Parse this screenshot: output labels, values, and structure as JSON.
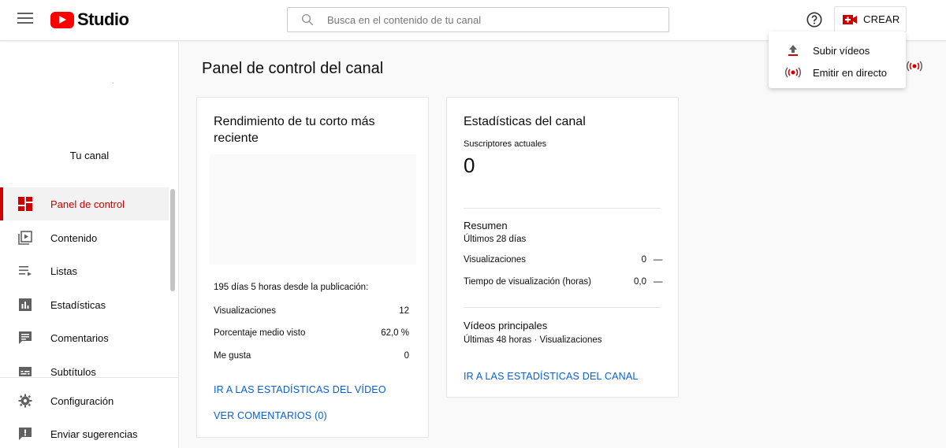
{
  "header": {
    "logo_text": "Studio",
    "search_placeholder": "Busca en el contenido de tu canal",
    "create_label": "CREAR"
  },
  "create_menu": {
    "items": [
      {
        "label": "Subir vídeos",
        "icon": "upload-icon"
      },
      {
        "label": "Emitir en directo",
        "icon": "live-icon"
      }
    ]
  },
  "sidebar": {
    "channel_label": "Tu canal",
    "items": [
      {
        "label": "Panel de control",
        "icon": "dashboard-icon",
        "active": true
      },
      {
        "label": "Contenido",
        "icon": "content-icon"
      },
      {
        "label": "Listas",
        "icon": "playlists-icon"
      },
      {
        "label": "Estadísticas",
        "icon": "analytics-icon"
      },
      {
        "label": "Comentarios",
        "icon": "comments-icon"
      },
      {
        "label": "Subtítulos",
        "icon": "subtitles-icon"
      }
    ],
    "bottom_items": [
      {
        "label": "Configuración",
        "icon": "settings-icon"
      },
      {
        "label": "Enviar sugerencias",
        "icon": "feedback-icon"
      }
    ]
  },
  "main": {
    "page_title": "Panel de control del canal",
    "latest_short": {
      "title": "Rendimiento de tu corto más reciente",
      "since_published": "195 días 5 horas desde la publicación:",
      "stats": [
        {
          "label": "Visualizaciones",
          "value": "12"
        },
        {
          "label": "Porcentaje medio visto",
          "value": "62,0 %"
        },
        {
          "label": "Me gusta",
          "value": "0"
        }
      ],
      "link_stats": "IR A LAS ESTADÍSTICAS DEL VÍDEO",
      "link_comments": "VER COMENTARIOS (0)"
    },
    "channel_stats": {
      "title": "Estadísticas del canal",
      "subscribers_label": "Suscriptores actuales",
      "subscribers_value": "0",
      "summary_title": "Resumen",
      "summary_period": "Últimos 28 días",
      "summary_rows": [
        {
          "label": "Visualizaciones",
          "value": "0",
          "trend": "—"
        },
        {
          "label": "Tiempo de visualización (horas)",
          "value": "0,0",
          "trend": "—"
        }
      ],
      "top_videos_title": "Vídeos principales",
      "top_videos_period": "Últimas 48 horas · Visualizaciones",
      "link_channel_stats": "IR A LAS ESTADÍSTICAS DEL CANAL"
    }
  },
  "colors": {
    "accent_red": "#cc0000",
    "link_blue": "#065fd4"
  }
}
